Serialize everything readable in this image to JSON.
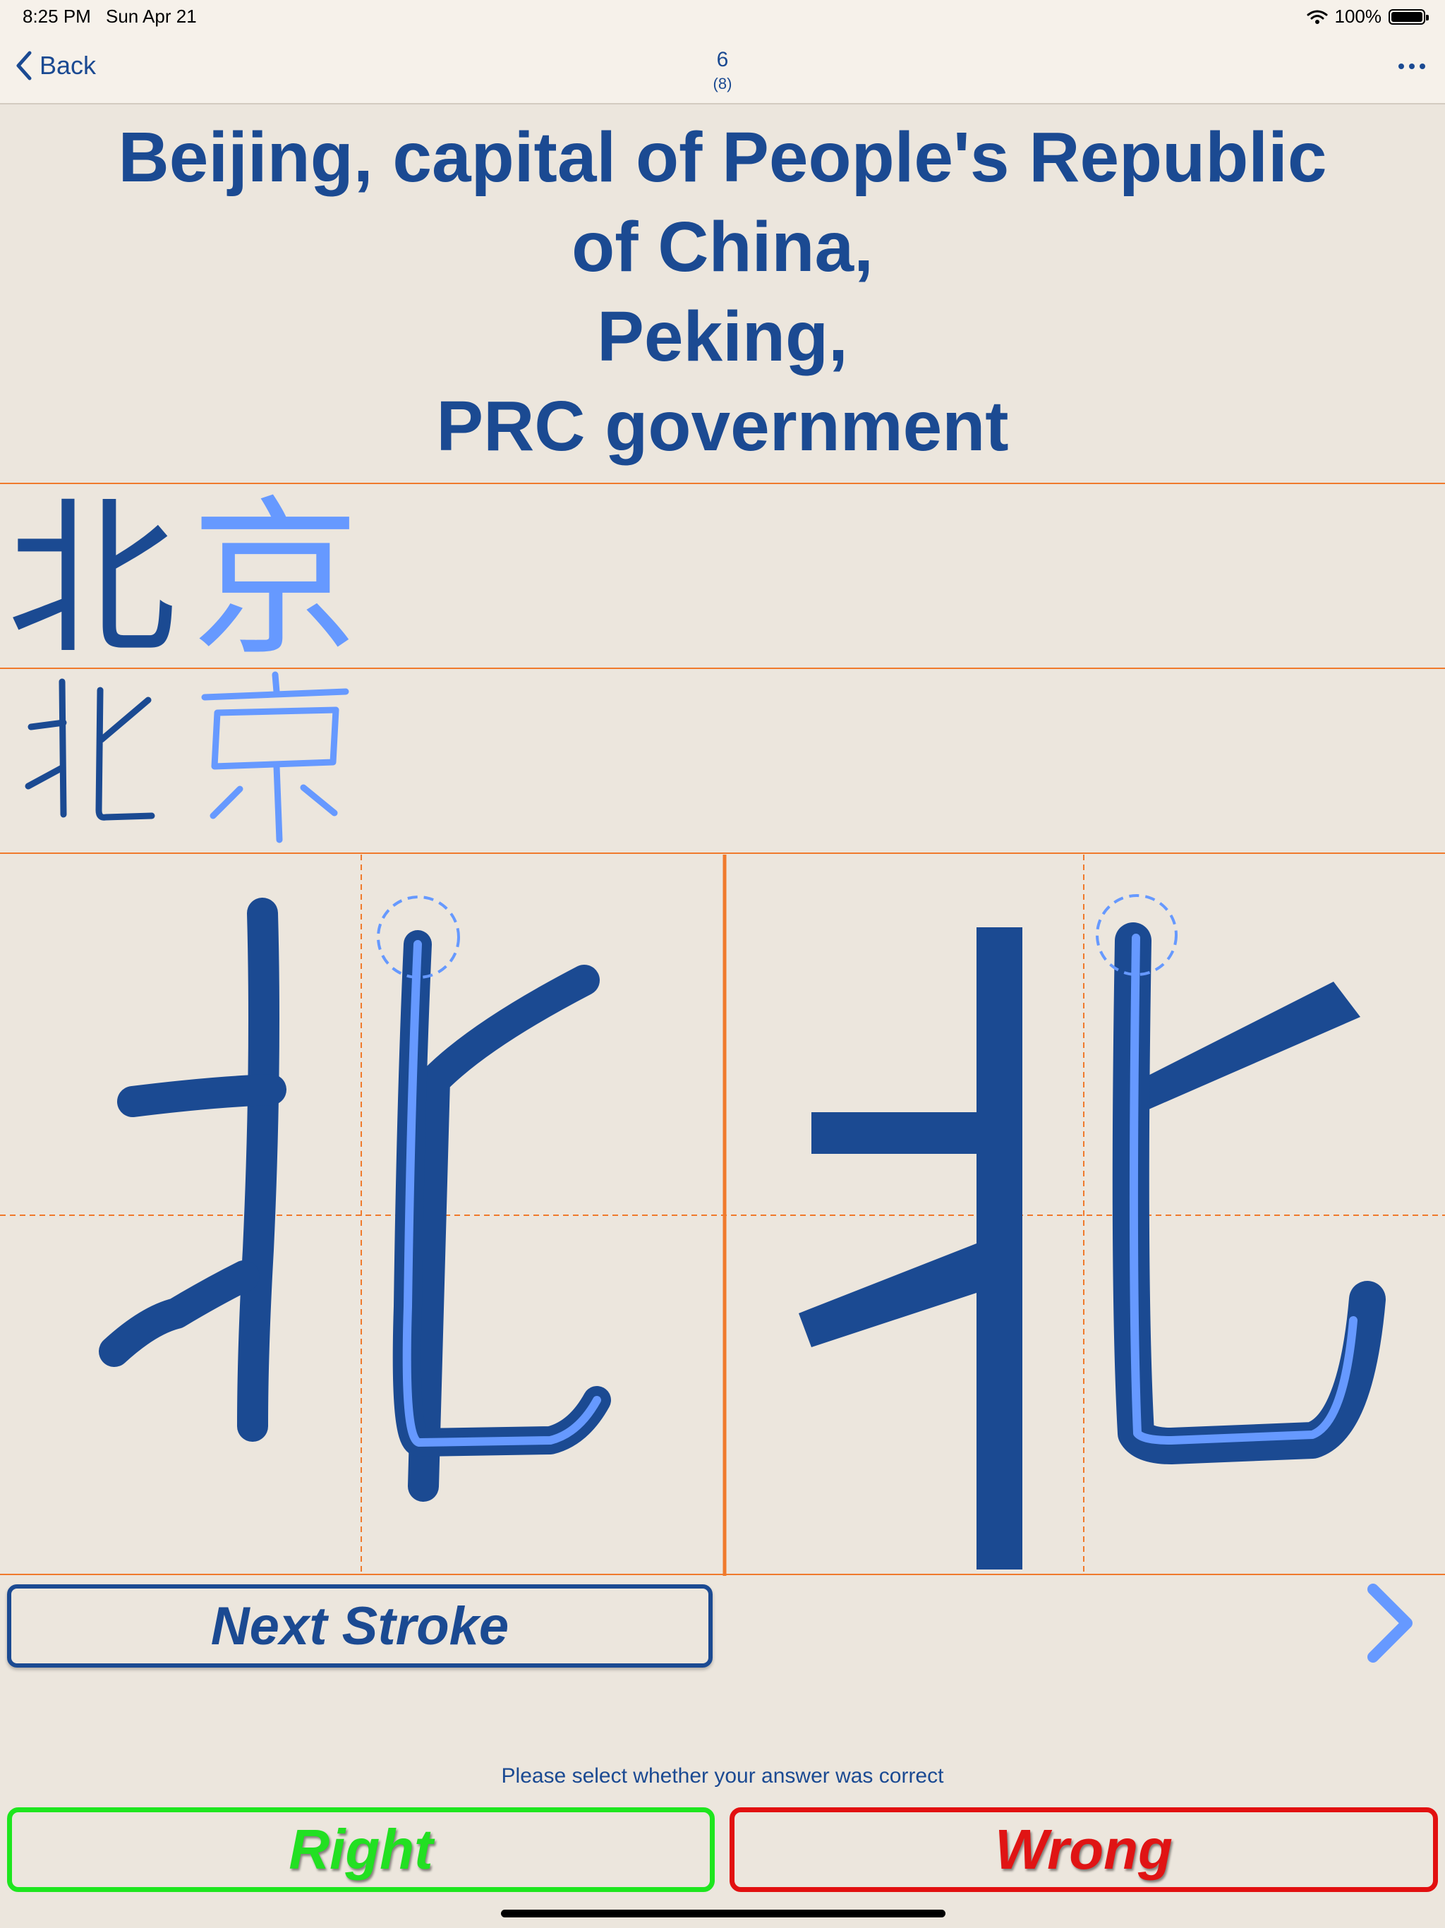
{
  "status_bar": {
    "time": "8:25 PM",
    "date": "Sun Apr 21",
    "battery": "100%"
  },
  "nav": {
    "back_label": "Back",
    "title": "6",
    "subtitle": "(8)"
  },
  "question": {
    "lines": [
      "Beijing, capital of People's Republic",
      "of China,",
      "Peking,",
      "PRC government"
    ]
  },
  "answer": {
    "characters": [
      "北",
      "京"
    ],
    "current_character": "北",
    "stroke_number": 5
  },
  "buttons": {
    "next_stroke": "Next Stroke",
    "right": "Right",
    "wrong": "Wrong"
  },
  "prompt": "Please select whether your answer was correct",
  "colors": {
    "primary_blue": "#1b4a92",
    "light_blue": "#6699ff",
    "grid_orange": "#f07a2c",
    "right_green": "#22e022",
    "wrong_red": "#e01414",
    "background": "#ece6dd"
  },
  "icons": [
    "wifi-icon",
    "battery-icon",
    "chevron-left-icon",
    "more-icon",
    "chevron-right-icon"
  ]
}
